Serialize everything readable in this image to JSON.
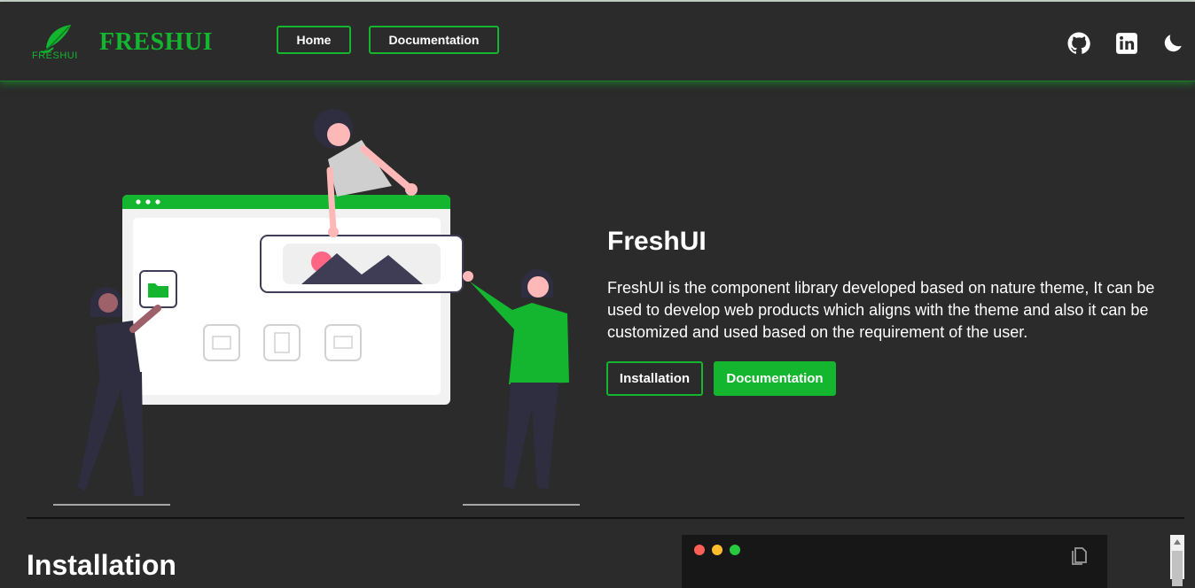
{
  "brand": {
    "logo_text": "FRESHUI",
    "name": "FRESHUI",
    "accent_color": "#14b52f"
  },
  "nav": {
    "home_label": "Home",
    "docs_label": "Documentation",
    "icons": [
      "github-icon",
      "linkedin-icon",
      "moon-icon"
    ]
  },
  "hero": {
    "title": "FreshUI",
    "description": "FreshUI is the component library developed based on nature theme, It can be used to develop web products which aligns with the theme and also it can be customized and used based on the requirement of the user.",
    "install_button": "Installation",
    "docs_button": "Documentation"
  },
  "installation": {
    "title": "Installation"
  },
  "colors": {
    "background": "#2b2b2b",
    "accent": "#14b52f",
    "code_background": "#171717"
  }
}
